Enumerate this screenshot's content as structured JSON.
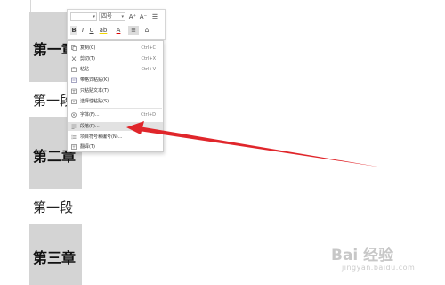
{
  "document": {
    "heading_1": "第一章",
    "para_1": "第一段",
    "heading_2": "第二章",
    "para_2": "第一段",
    "heading_3": "第三章"
  },
  "toolbar": {
    "font_name": "",
    "font_size": "四号",
    "grow_font": "A⁺",
    "shrink_font": "A⁻",
    "line_spacing": "☰",
    "bold": "B",
    "italic": "I",
    "underline": "U",
    "highlight": "ab",
    "font_color": "A",
    "paragraph": "≡",
    "styles": "⌂"
  },
  "context_menu": {
    "items": [
      {
        "label": "复制(C)",
        "shortcut": "Ctrl+C",
        "icon": "copy-icon"
      },
      {
        "label": "剪切(T)",
        "shortcut": "Ctrl+X",
        "icon": "cut-icon"
      },
      {
        "label": "粘贴",
        "shortcut": "Ctrl+V",
        "icon": "paste-icon"
      },
      {
        "label": "带格式粘贴(K)",
        "shortcut": "",
        "icon": "paste-format-icon"
      },
      {
        "label": "只粘贴文本(T)",
        "shortcut": "",
        "icon": "paste-text-icon"
      },
      {
        "label": "选择性粘贴(S)...",
        "shortcut": "",
        "icon": "paste-special-icon"
      },
      {
        "label": "字体(F)...",
        "shortcut": "Ctrl+D",
        "icon": "font-icon"
      },
      {
        "label": "段落(P)...",
        "shortcut": "",
        "icon": "paragraph-icon"
      },
      {
        "label": "项目符号和编号(N)...",
        "shortcut": "",
        "icon": "bullets-icon"
      },
      {
        "label": "翻译(T)",
        "shortcut": "",
        "icon": "translate-icon"
      }
    ]
  },
  "annotation": {
    "arrow_color": "#e0262b"
  },
  "watermark": {
    "brand": "Bai 经验",
    "url": "jingyan.baidu.com"
  }
}
